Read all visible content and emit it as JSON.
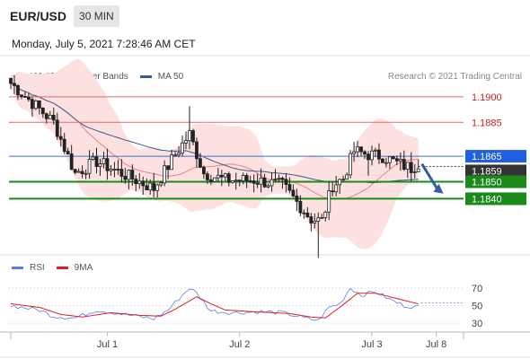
{
  "header": {
    "symbol": "EUR/USD",
    "interval": "30 MIN",
    "datetime": "Monday, July 5, 2021 7:28:46 AM CET"
  },
  "legend_top": [
    {
      "label": "MA 20 + Bollinger Bands",
      "color": "#f08080"
    },
    {
      "label": "MA 50",
      "color": "#3a5a8c"
    }
  ],
  "credit": "Research © 2021 Trading Central",
  "legend_bottom": [
    {
      "label": "RSI",
      "color": "#5b7fd9"
    },
    {
      "label": "9MA",
      "color": "#e02020"
    }
  ],
  "colors": {
    "candle": "#222222",
    "bollinger_fill": "#fde0e0",
    "ma20": "#f08080",
    "ma50": "#3a5a8c",
    "resistance": "#e06a6a",
    "support": "#1a8a1a",
    "pivot": "#3d6fd1",
    "arrow": "#2f5f9e",
    "current_price_badge": "#333333",
    "support_badge": "#1a8a1a",
    "pivot_badge": "#1f5fe0",
    "resistance_text": "#d02020"
  },
  "chart_data": [
    {
      "type": "candlestick",
      "title": "EUR/USD 30 MIN",
      "ylim": [
        1.1808,
        1.192
      ],
      "x_ticks": [
        {
          "label": "Jul 1",
          "index": 27
        },
        {
          "label": "Jul 2",
          "index": 64
        },
        {
          "label": "Jul 3",
          "index": 101
        },
        {
          "label": "Jul 8",
          "index": 119
        }
      ],
      "levels": [
        {
          "value": 1.19,
          "label": "1.1900",
          "kind": "resistance"
        },
        {
          "value": 1.1885,
          "label": "1.1885",
          "kind": "resistance"
        },
        {
          "value": 1.1865,
          "label": "1.1865",
          "kind": "pivot"
        },
        {
          "value": 1.1859,
          "label": "1.1859",
          "kind": "current"
        },
        {
          "value": 1.185,
          "label": "1.1850",
          "kind": "support"
        },
        {
          "value": 1.184,
          "label": "1.1840",
          "kind": "support"
        }
      ],
      "anchors": [
        {
          "i": 0,
          "p": 1.1908,
          "u": 1.0,
          "l": 0.35
        },
        {
          "i": 12,
          "p": 1.1885,
          "u": 1.05,
          "l": 0.55
        },
        {
          "i": 18,
          "p": 1.1855,
          "u": 1.15,
          "l": 0.95
        },
        {
          "i": 24,
          "p": 1.1862,
          "u": 1.18,
          "l": 0.98
        },
        {
          "i": 34,
          "p": 1.1852,
          "u": 1.15,
          "l": 0.95
        },
        {
          "i": 40,
          "p": 1.1846,
          "u": 1.14,
          "l": 0.8
        },
        {
          "i": 46,
          "p": 1.1866,
          "u": 1.04,
          "l": 0.74
        },
        {
          "i": 50,
          "p": 1.1878,
          "u": 1.2,
          "l": 1.0
        },
        {
          "i": 54,
          "p": 1.1855,
          "u": 1.2,
          "l": 1.0
        },
        {
          "i": 60,
          "p": 1.1851,
          "u": 1.15,
          "l": 0.95
        },
        {
          "i": 68,
          "p": 1.1851,
          "u": 1.3,
          "l": 0.95
        },
        {
          "i": 76,
          "p": 1.1848,
          "u": 1.3,
          "l": 0.95
        },
        {
          "i": 80,
          "p": 1.1838,
          "u": 1.25,
          "l": 0.9
        },
        {
          "i": 84,
          "p": 1.1828,
          "u": 1.3,
          "l": 0.75
        },
        {
          "i": 87,
          "p": 1.1827,
          "u": 1.35,
          "l": 0.95
        },
        {
          "i": 90,
          "p": 1.1848,
          "u": 1.4,
          "l": 0.9
        },
        {
          "i": 93,
          "p": 1.1852,
          "u": 1.25,
          "l": 0.95
        },
        {
          "i": 96,
          "p": 1.1868,
          "u": 0.9,
          "l": 0.75
        },
        {
          "i": 100,
          "p": 1.1866,
          "u": 1.05,
          "l": 0.85
        },
        {
          "i": 104,
          "p": 1.1865,
          "u": 1.15,
          "l": 0.9
        },
        {
          "i": 108,
          "p": 1.1861,
          "u": 1.15,
          "l": 1.0
        },
        {
          "i": 112,
          "p": 1.1858,
          "u": 1.25,
          "l": 1.0
        },
        {
          "i": 114,
          "p": 1.1861,
          "u": 1.25,
          "l": 1.0
        }
      ],
      "projection": {
        "from_index": 114,
        "from_price": 1.1861,
        "to_index": 121,
        "to_price": 1.1843
      }
    },
    {
      "type": "line",
      "title": "RSI",
      "ylim": [
        20,
        80
      ],
      "y_ticks": [
        30,
        50,
        70
      ],
      "series": [
        {
          "name": "RSI",
          "anchors": [
            {
              "i": 0,
              "v": 50
            },
            {
              "i": 8,
              "v": 45
            },
            {
              "i": 12,
              "v": 38
            },
            {
              "i": 18,
              "v": 36
            },
            {
              "i": 24,
              "v": 45
            },
            {
              "i": 32,
              "v": 40
            },
            {
              "i": 40,
              "v": 35
            },
            {
              "i": 44,
              "v": 45
            },
            {
              "i": 48,
              "v": 62
            },
            {
              "i": 50,
              "v": 70
            },
            {
              "i": 52,
              "v": 64
            },
            {
              "i": 56,
              "v": 44
            },
            {
              "i": 62,
              "v": 42
            },
            {
              "i": 70,
              "v": 43
            },
            {
              "i": 76,
              "v": 42
            },
            {
              "i": 82,
              "v": 36
            },
            {
              "i": 86,
              "v": 33
            },
            {
              "i": 89,
              "v": 48
            },
            {
              "i": 92,
              "v": 52
            },
            {
              "i": 95,
              "v": 70
            },
            {
              "i": 98,
              "v": 62
            },
            {
              "i": 102,
              "v": 66
            },
            {
              "i": 106,
              "v": 57
            },
            {
              "i": 110,
              "v": 50
            },
            {
              "i": 114,
              "v": 48
            }
          ]
        },
        {
          "name": "9MA",
          "anchors": [
            {
              "i": 0,
              "v": 52
            },
            {
              "i": 8,
              "v": 48
            },
            {
              "i": 14,
              "v": 40
            },
            {
              "i": 20,
              "v": 37
            },
            {
              "i": 28,
              "v": 42
            },
            {
              "i": 36,
              "v": 39
            },
            {
              "i": 42,
              "v": 38
            },
            {
              "i": 46,
              "v": 46
            },
            {
              "i": 52,
              "v": 60
            },
            {
              "i": 56,
              "v": 52
            },
            {
              "i": 60,
              "v": 45
            },
            {
              "i": 68,
              "v": 43
            },
            {
              "i": 78,
              "v": 41
            },
            {
              "i": 84,
              "v": 37
            },
            {
              "i": 88,
              "v": 36
            },
            {
              "i": 92,
              "v": 48
            },
            {
              "i": 97,
              "v": 64
            },
            {
              "i": 102,
              "v": 64
            },
            {
              "i": 108,
              "v": 58
            },
            {
              "i": 114,
              "v": 52
            }
          ]
        }
      ],
      "projection": {
        "from_index": 114,
        "to_index": 121,
        "value": 53
      }
    }
  ]
}
